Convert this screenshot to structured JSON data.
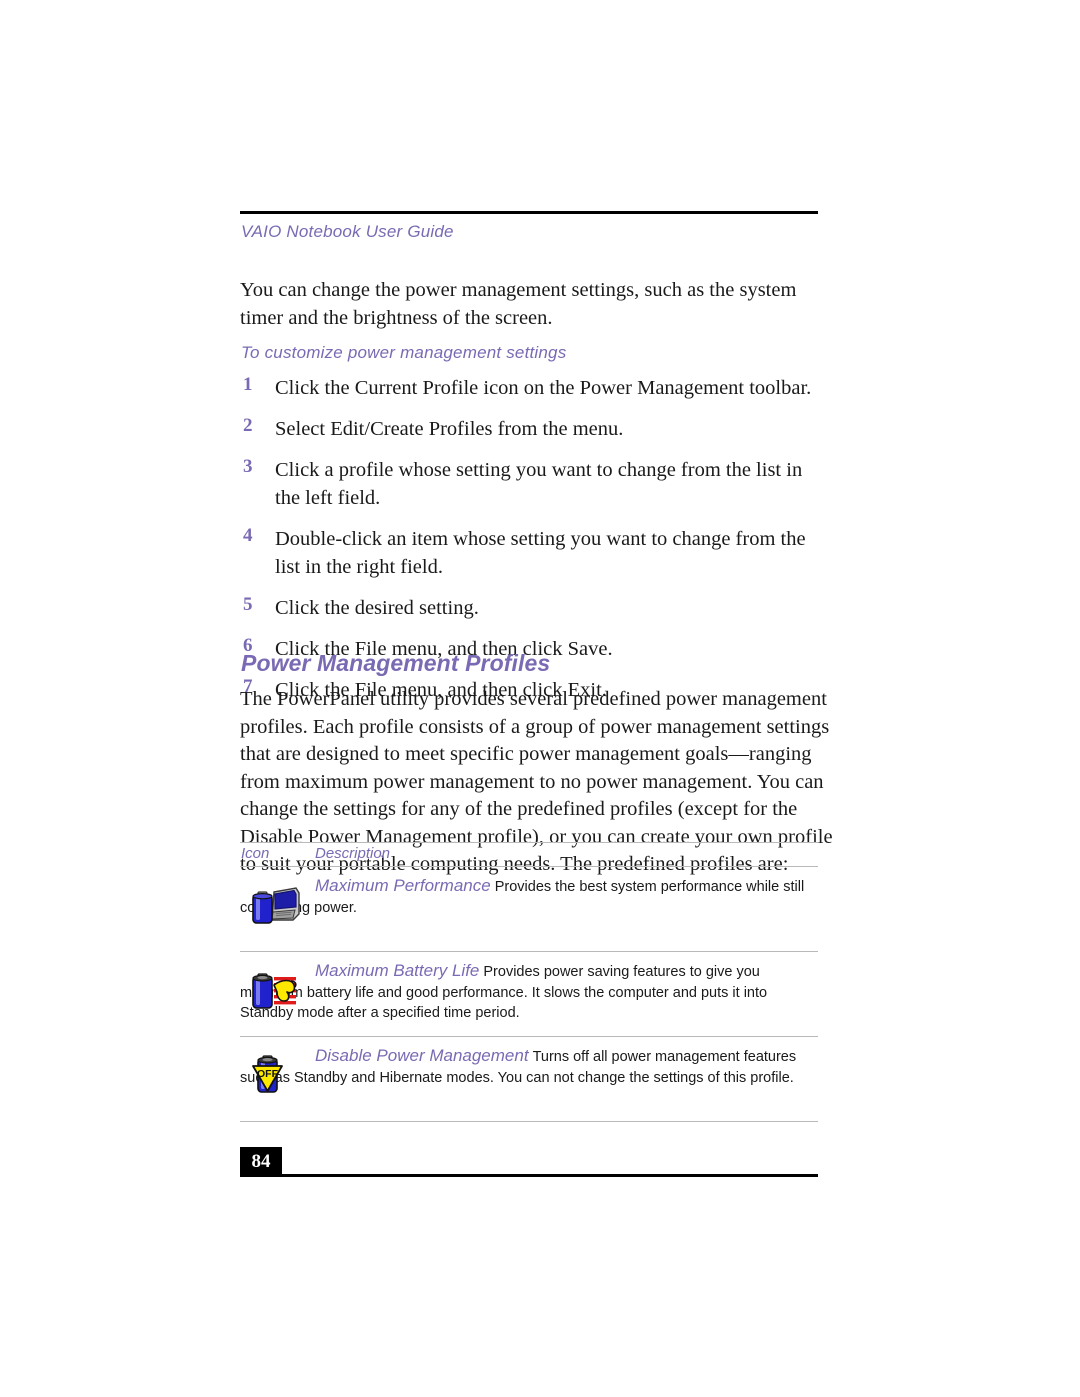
{
  "header": {
    "title": "VAIO Notebook User Guide"
  },
  "intro_paragraph": "You can change the power management settings, such as the system timer and the brightness of the screen.",
  "procedure": {
    "heading": "To customize power management settings",
    "steps": [
      {
        "number": "1",
        "text": "Click the Current Profile icon on the Power Management toolbar."
      },
      {
        "number": "2",
        "text": "Select Edit/Create Profiles from the menu."
      },
      {
        "number": "3",
        "text": "Click a profile whose setting you want to change from the list in the left field."
      },
      {
        "number": "4",
        "text": "Double-click an item whose setting you want to change from the list in the right field."
      },
      {
        "number": "5",
        "text": "Click the desired setting."
      },
      {
        "number": "6",
        "text": "Click the File menu, and then click Save."
      },
      {
        "number": "7",
        "text": "Click the File menu, and then click Exit."
      }
    ]
  },
  "section": {
    "title": "Power Management Profiles",
    "body": "The PowerPanel utility provides several predefined power management profiles. Each profile consists of a group of power management settings that are designed to meet specific power management goals—ranging from maximum power management to no power management. You can change the settings for any of the predefined profiles (except for the Disable Power Management profile), or you can create your own profile to suit your portable computing needs. The predefined profiles are:"
  },
  "profile_table": {
    "columns": {
      "icon": "Icon",
      "description": "Description"
    },
    "rows": [
      {
        "icon_name": "battery-laptop-icon",
        "title": "Maximum Performance",
        "description": "Provides the best system performance while still conserving power."
      },
      {
        "icon_name": "battery-muscle-arm-icon",
        "title": "Maximum Battery Life",
        "description": "Provides power saving features to give you maximum battery life and good performance. It slows the computer and puts it into Standby mode after a specified time period."
      },
      {
        "icon_name": "battery-off-icon",
        "title": "Disable Power Management",
        "description": "Turns off all power management features such as Standby and Hibernate modes. You can not change the settings of this profile.",
        "icon_label": "OFF"
      }
    ]
  },
  "footer": {
    "page_number": "84"
  },
  "colors": {
    "accent_purple": "#7a6ab3",
    "rule_black": "#000000",
    "table_rule": "#b9b9b9",
    "battery_blue": "#2222cc",
    "icon_yellow": "#ffe800",
    "icon_red": "#e01b1b",
    "icon_gray": "#9a9a9a"
  }
}
